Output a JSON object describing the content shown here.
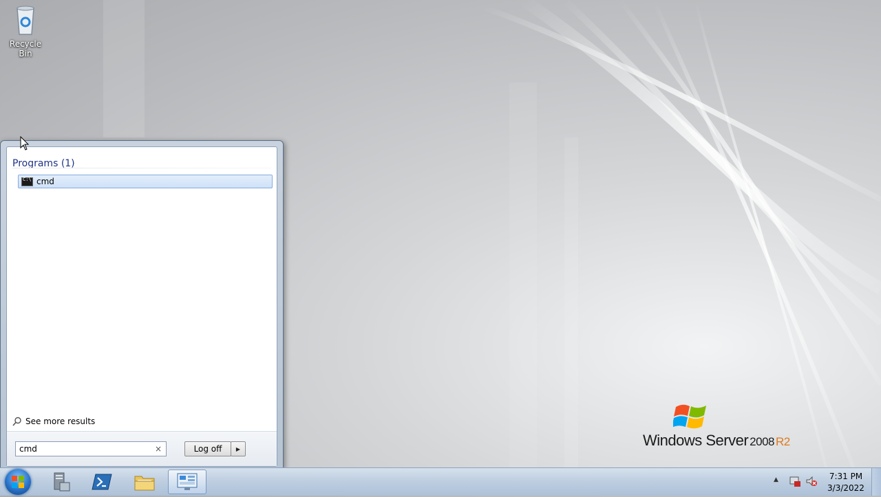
{
  "desktop": {
    "recycle_bin_label": "Recycle Bin",
    "branding": {
      "word1": "Windows Server",
      "version": "2008",
      "edition": "R2"
    }
  },
  "start_menu": {
    "section_header": "Programs (1)",
    "results": [
      {
        "label": "cmd",
        "icon": "cmd-icon",
        "selected": true
      }
    ],
    "see_more_label": "See more results",
    "search": {
      "value": "cmd",
      "clear_icon": "×"
    },
    "logoff_label": "Log off",
    "logoff_arrow": "▶"
  },
  "taskbar": {
    "pinned": [
      {
        "name": "server-manager",
        "icon": "server-manager-icon"
      },
      {
        "name": "powershell",
        "icon": "powershell-icon"
      },
      {
        "name": "explorer",
        "icon": "folder-icon"
      },
      {
        "name": "control-panel",
        "icon": "control-panel-icon",
        "active": true
      }
    ],
    "tray_arrow": "▲",
    "clock": {
      "time": "7:31 PM",
      "date": "3/3/2022"
    }
  },
  "colors": {
    "accent": "#1e3287",
    "selection": "#cfe1f8",
    "edition": "#e07a1f"
  }
}
